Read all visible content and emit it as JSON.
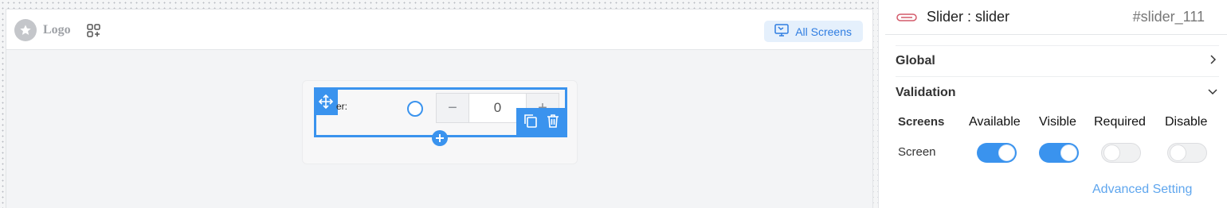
{
  "canvas": {
    "logo_text": "Logo",
    "all_screens_label": "All Screens",
    "widget": {
      "label": "er:",
      "stepper_value": "0",
      "minus_symbol": "−",
      "plus_symbol": "+"
    }
  },
  "panel": {
    "component_name": "Slider : slider",
    "component_id": "#slider_111",
    "sections": {
      "global": "Global",
      "validation": "Validation"
    },
    "table": {
      "headers": {
        "screens": "Screens",
        "available": "Available",
        "visible": "Visible",
        "required": "Required",
        "disable": "Disable"
      },
      "row_label": "Screen",
      "toggles": {
        "available": true,
        "visible": true,
        "required": false,
        "disable": false
      }
    },
    "advanced_setting": "Advanced Setting"
  },
  "colors": {
    "accent": "#3a93ee",
    "link": "#5fa6ee",
    "chip_bg": "#e5f0fc"
  },
  "icons": {
    "logo": "star-icon",
    "apps": "apps-add-icon",
    "all_screens": "monitor-icon",
    "move": "move-arrows-icon",
    "copy": "copy-icon",
    "delete": "trash-icon",
    "add": "plus-circle-icon",
    "component": "slider-component-icon",
    "global_chevron": "chevron-right-icon",
    "validation_chevron": "chevron-down-icon"
  }
}
